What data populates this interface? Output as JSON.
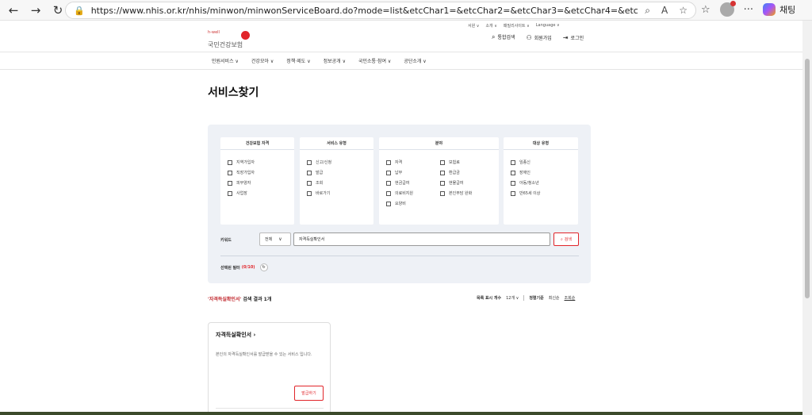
{
  "browser": {
    "url": "https://www.nhis.or.kr/nhis/minwon/minwonServiceBoard.do?mode=list&etcChar1=&etcChar2=&etcChar3=&etcChar4=&etcChar5=&etcChar6=&...",
    "chat_label": "채팅"
  },
  "header": {
    "logo_small": "h-well",
    "logo_name": "국민건강보험",
    "util_top": [
      "서원 ∨",
      "소개 ∨",
      "패밀리사이트 ∨",
      "Language ∨"
    ],
    "util_main": [
      {
        "icon": "search-icon",
        "label": "통합검색"
      },
      {
        "icon": "user-plus-icon",
        "label": "회원가입"
      },
      {
        "icon": "login-icon",
        "label": "로그인"
      }
    ]
  },
  "gnb": [
    "민원서비스 ∨",
    "건강모아 ∨",
    "정책·제도 ∨",
    "정보공개 ∨",
    "국민소통·참여 ∨",
    "공단소개 ∨"
  ],
  "page_title": "서비스찾기",
  "filters": {
    "columns": [
      {
        "title": "건강보험 자격",
        "items": [
          "지역가입자",
          "직장가입자",
          "피부양자",
          "사업장"
        ]
      },
      {
        "title": "서비스 유형",
        "items": [
          "신고/신청",
          "발급",
          "조회",
          "바로가기"
        ]
      },
      {
        "title": "분야",
        "items_left": [
          "자격",
          "납부",
          "현금급여",
          "의료비지원",
          "요양비"
        ],
        "items_right": [
          "보험료",
          "환급금",
          "현물급여",
          "본인부담 완화"
        ]
      },
      {
        "title": "대상 유형",
        "items": [
          "임종신",
          "장애인",
          "아동/청소년",
          "만65세 이상"
        ]
      }
    ],
    "keyword_label": "키워드",
    "keyword_scope": "전체",
    "keyword_value": "자격득실확인서",
    "search_label": "검색",
    "selected_label": "선택된 필터",
    "selected_count": "(0/10)"
  },
  "results": {
    "query": "'자격득실확인서'",
    "summary_rest": " 검색 결과 1개",
    "per_page_label": "목록 표시 개수",
    "per_page_value": "12개 ∨",
    "sort_label": "정렬기준",
    "sort_new": "최신순",
    "sort_views": "조회순"
  },
  "card": {
    "title": "자격득실확인서 ›",
    "description": "본인의 자격득실확인서를 발급받을 수 있는 서비스 입니다.",
    "button": "발급하기"
  }
}
